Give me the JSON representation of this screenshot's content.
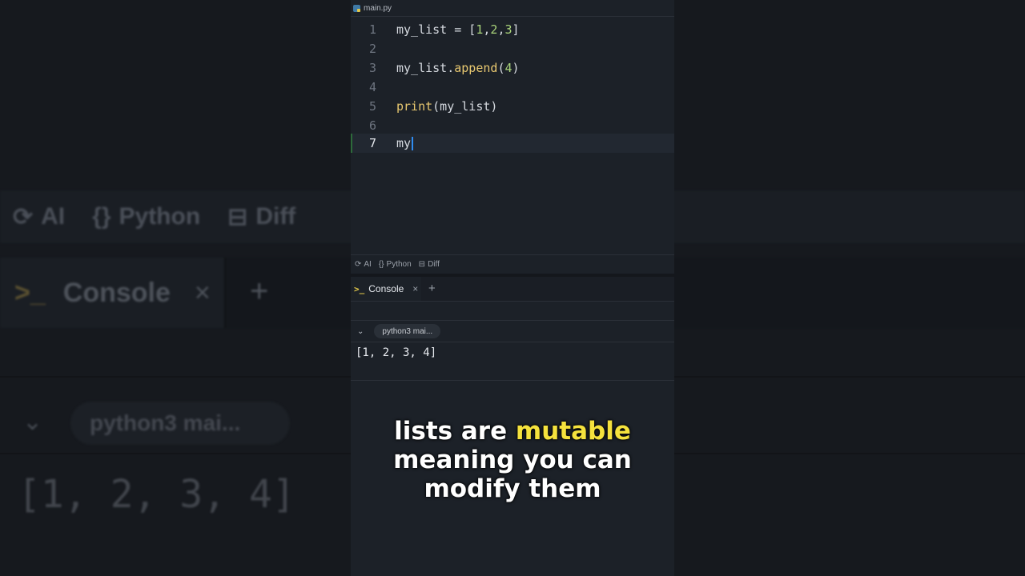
{
  "background": {
    "toolbar": {
      "ai": "AI",
      "python": "Python",
      "diff": "Diff"
    },
    "console_tab": "Console",
    "chip": "python3 mai...",
    "output": "[1, 2, 3, 4]"
  },
  "editor": {
    "file_tab": "main.py",
    "lines": [
      {
        "num": "1"
      },
      {
        "num": "2"
      },
      {
        "num": "3"
      },
      {
        "num": "4"
      },
      {
        "num": "5"
      },
      {
        "num": "6"
      },
      {
        "num": "7"
      }
    ],
    "code": {
      "l1_var": "my_list = [",
      "l1_n1": "1",
      "l1_c1": ",",
      "l1_n2": "2",
      "l1_c2": ",",
      "l1_n3": "3",
      "l1_end": "]",
      "l3_obj": "my_list.",
      "l3_fn": "append",
      "l3_open": "(",
      "l3_num": "4",
      "l3_close": ")",
      "l5_fn": "print",
      "l5_args": "(my_list)",
      "l7_text": "my"
    }
  },
  "statusbar": {
    "ai": "AI",
    "python": "Python",
    "diff": "Diff"
  },
  "console": {
    "tab_label": "Console",
    "close": "×",
    "add": "+",
    "chip": "python3 mai...",
    "output": "[1, 2, 3, 4]"
  },
  "caption": {
    "line1_a": "lists are ",
    "line1_hl": "mutable",
    "line2": "meaning you can",
    "line3": "modify them"
  },
  "colors": {
    "highlight": "#f5e23d",
    "panel": "#1c2128",
    "caret": "#2f8cf0"
  }
}
